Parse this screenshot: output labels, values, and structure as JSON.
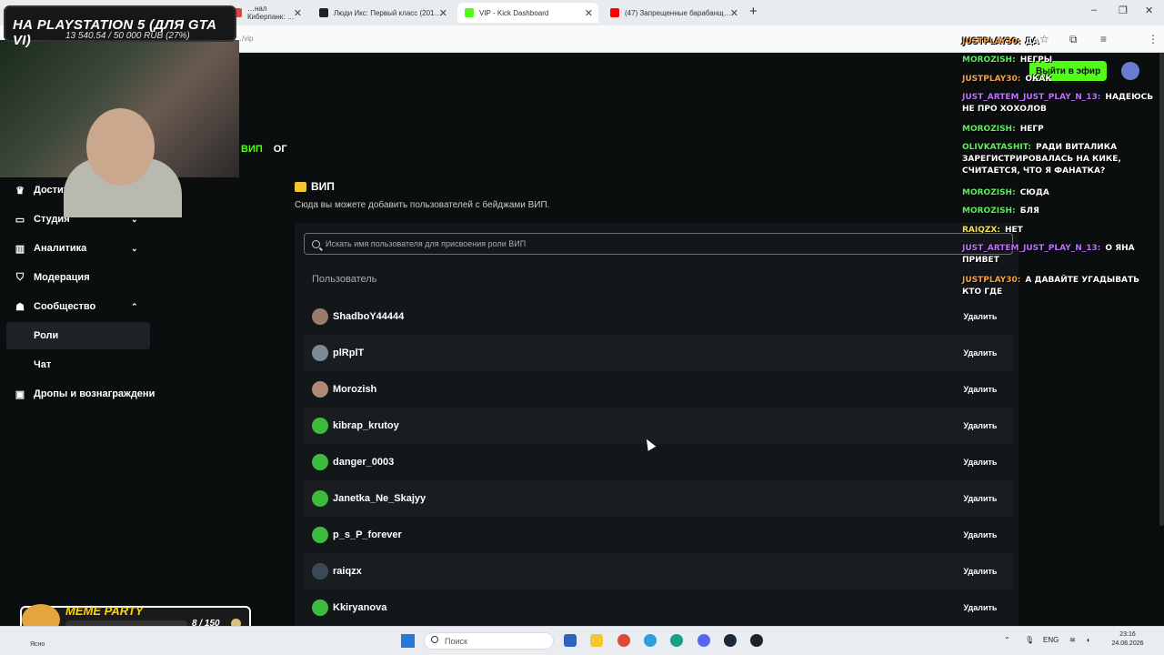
{
  "browser": {
    "tabs": [
      {
        "label": "…нал Киберпанк: …",
        "color": "#d44",
        "active": false
      },
      {
        "label": "Люди Икс: Первый класс (201…",
        "color": "#222",
        "active": false
      },
      {
        "label": "VIP - Kick Dashboard",
        "color": "#53fc18",
        "active": true
      },
      {
        "label": "(47) Запрещенные барабанщ…",
        "color": "#f00",
        "active": false
      }
    ],
    "url": "…/vip"
  },
  "topbar": {
    "go_live_label": "Выйти в эфир"
  },
  "subtabs": [
    "ВИП",
    "ОГ"
  ],
  "sidebar": {
    "items": [
      {
        "label": "Достижения",
        "icon": "trophy-icon",
        "chev": "",
        "active": false,
        "sub": false
      },
      {
        "label": "Студия",
        "icon": "studio-icon",
        "chev": "⌄",
        "active": false,
        "sub": false
      },
      {
        "label": "Аналитика",
        "icon": "analytics-icon",
        "chev": "⌄",
        "active": false,
        "sub": false
      },
      {
        "label": "Модерация",
        "icon": "shield-icon",
        "chev": "",
        "active": false,
        "sub": false
      },
      {
        "label": "Сообщество",
        "icon": "community-icon",
        "chev": "⌃",
        "active": false,
        "sub": false
      },
      {
        "label": "Роли",
        "icon": "",
        "chev": "",
        "active": true,
        "sub": true
      },
      {
        "label": "Чат",
        "icon": "",
        "chev": "",
        "active": false,
        "sub": true
      },
      {
        "label": "Дропы и вознаграждени",
        "icon": "gift-icon",
        "chev": "",
        "active": false,
        "sub": false
      }
    ]
  },
  "vip": {
    "title": "ВИП",
    "description": "Сюда вы можете добавить пользователей с бейджами ВИП.",
    "search_placeholder": "Искать имя пользователя для присвоения роли ВИП",
    "column_user": "Пользователь",
    "delete_label": "Удалить",
    "users": [
      {
        "name": "ShadboY44444",
        "avatar_color": "#9a7a6a"
      },
      {
        "name": "plRplT",
        "avatar_color": "#7c8a96"
      },
      {
        "name": "Morozish",
        "avatar_color": "#b08a74"
      },
      {
        "name": "kibrap_krutoy",
        "avatar_color": "#3dbb3d"
      },
      {
        "name": "danger_0003",
        "avatar_color": "#3dbb3d"
      },
      {
        "name": "Janetka_Ne_Skajyy",
        "avatar_color": "#3dbb3d"
      },
      {
        "name": "p_s_P_forever",
        "avatar_color": "#3dbb3d"
      },
      {
        "name": "raiqzx",
        "avatar_color": "#3b4a5a"
      },
      {
        "name": "Kkiryanova",
        "avatar_color": "#3dbb3d"
      }
    ]
  },
  "stream": {
    "goal_title": "НА PLAYSTATION 5 (ДЛЯ GTA VI)",
    "goal_progress": "13 540.54 / 50 000 RUB (27%)",
    "meme_title": "MEME PARTY",
    "meme_count": "8 / 150"
  },
  "chat": {
    "messages": [
      {
        "user": "JUSTPLAY30:",
        "text": "ДА",
        "color": "#f4a24a"
      },
      {
        "user": "MOROZISH:",
        "text": "НЕГРЫ",
        "color": "#5cf05c"
      },
      {
        "user": "JUSTPLAY30:",
        "text": "ОКАК",
        "color": "#f4a24a"
      },
      {
        "user": "JUST_ARTEM_JUST_PLAY_N_13:",
        "text": "НАДЕЮСЬ НЕ ПРО ХОХОЛОВ",
        "color": "#c070ff"
      },
      {
        "user": "MOROZISH:",
        "text": "НЕГР",
        "color": "#5cf05c"
      },
      {
        "user": "OLIVKATASHIT:",
        "text": "РАДИ ВИТАЛИКА ЗАРЕГИСТРИРОВАЛАСЬ НА КИКЕ, СЧИТАЕТСЯ, ЧТО Я ФАНАТКА?",
        "color": "#5cf05c"
      },
      {
        "user": "MOROZISH:",
        "text": "СЮДА",
        "color": "#5cf05c"
      },
      {
        "user": "MOROZISH:",
        "text": "БЛЯ",
        "color": "#5cf05c"
      },
      {
        "user": "RAIQZX:",
        "text": "НЕТ",
        "color": "#f4e24a"
      },
      {
        "user": "JUST_ARTEM_JUST_PLAY_N_13:",
        "text": "О ЯНА ПРИВЕТ",
        "color": "#c070ff"
      },
      {
        "user": "JUSTPLAY30:",
        "text": "А ДАВАЙТЕ УГАДЫВАТЬ КТО ГДЕ",
        "color": "#f4a24a"
      }
    ]
  },
  "taskbar": {
    "weather": "Ясно",
    "search_placeholder": "Поиск",
    "lang": "ENG",
    "time": "23:16",
    "date": "24.08.2026"
  }
}
